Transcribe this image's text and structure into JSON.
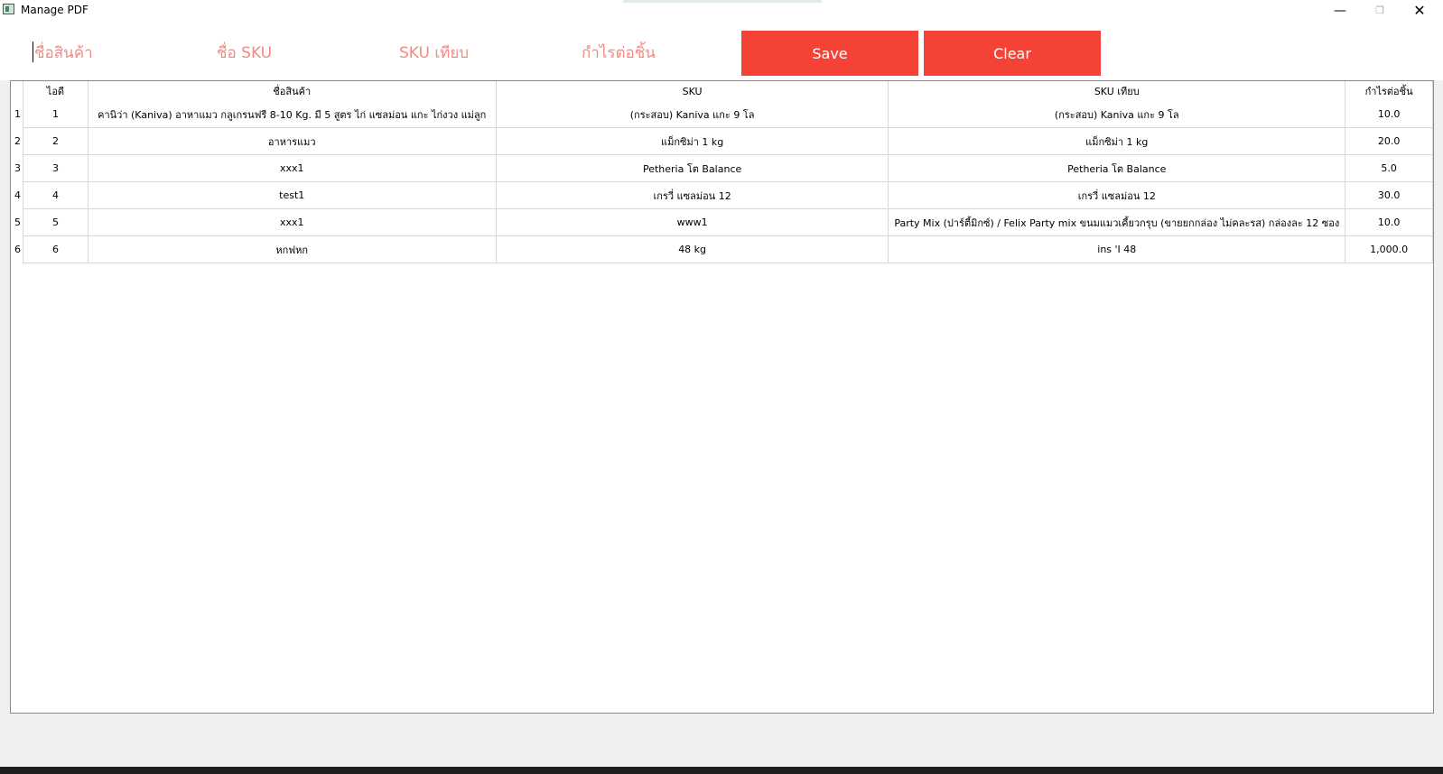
{
  "window": {
    "title": "Manage PDF",
    "minimize_glyph": "—",
    "maximize_glyph": "❐",
    "close_glyph": "✕"
  },
  "form": {
    "product_name_placeholder": "ชื่อสินค้า",
    "sku_name_placeholder": "ชื่อ SKU",
    "sku_compare_placeholder": "SKU เทียบ",
    "profit_placeholder": "กำไรต่อชิ้น",
    "save_label": "Save",
    "clear_label": "Clear"
  },
  "colors": {
    "button_bg": "#f44336",
    "placeholder": "#f08a82"
  },
  "table": {
    "headers": [
      "ไอดี",
      "ชื่อสินค้า",
      "SKU",
      "SKU เทียบ",
      "กำไรต่อชิ้น"
    ],
    "rows": [
      {
        "num": "1",
        "id": "1",
        "name": "คานิว่า (Kaniva) อาหาแมว กลูเกรนฟรี 8-10 Kg. มี 5 สูตร ไก่ แซลม่อน แกะ ไก่งวง แม่ลูก",
        "sku": "(กระสอบ) Kaniva แกะ 9 โล",
        "sku_compare": "(กระสอบ) Kaniva แกะ 9 โล",
        "profit": "10.0"
      },
      {
        "num": "2",
        "id": "2",
        "name": "อาหารแมว",
        "sku": "แม็กซิม่า 1 kg",
        "sku_compare": "แม็กซิม่า 1 kg",
        "profit": "20.0"
      },
      {
        "num": "3",
        "id": "3",
        "name": "xxx1",
        "sku": "Petheria โต Balance",
        "sku_compare": "Petheria โต Balance",
        "profit": "5.0"
      },
      {
        "num": "4",
        "id": "4",
        "name": "test1",
        "sku": "เกรวี่ แซลม่อน 12",
        "sku_compare": "เกรวี่ แซลม่อน 12",
        "profit": "30.0"
      },
      {
        "num": "5",
        "id": "5",
        "name": "xxx1",
        "sku": "www1",
        "sku_compare": "Party Mix (ปาร์ตี้มิกซ์) / Felix Party mix ขนมแมวเคี้ยวกรุบ (ขายยกกล่อง ไม่คละรส) กล่องละ 12 ซอง",
        "profit": "10.0"
      },
      {
        "num": "6",
        "id": "6",
        "name": "หกฟหก",
        "sku": "48 kg",
        "sku_compare": "ins 'I 48",
        "profit": "1,000.0"
      }
    ]
  }
}
